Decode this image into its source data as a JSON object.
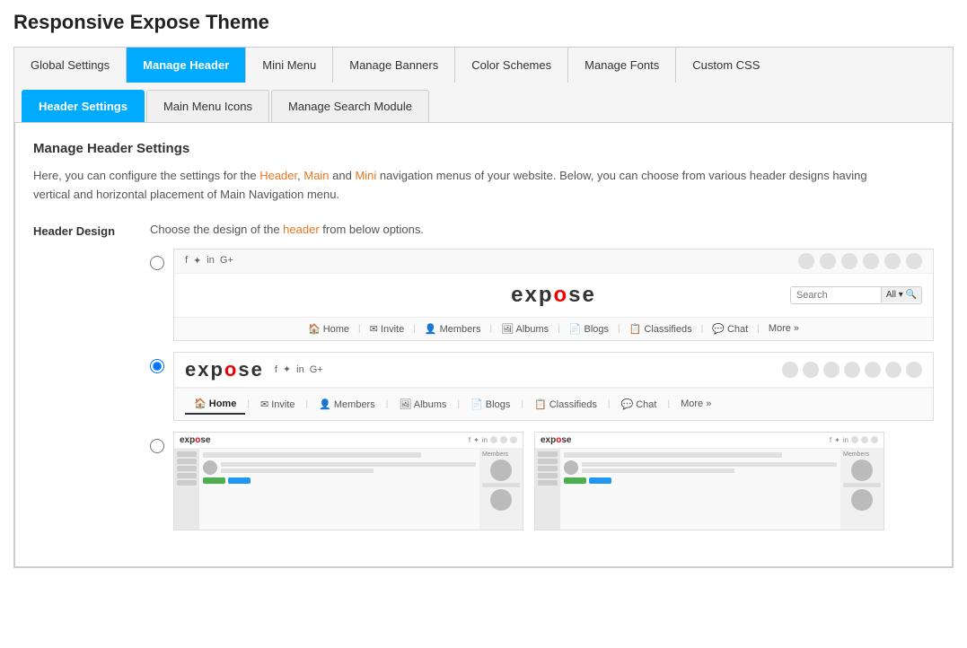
{
  "page": {
    "title": "Responsive Expose Theme"
  },
  "primary_tabs": [
    {
      "id": "global-settings",
      "label": "Global Settings",
      "active": false
    },
    {
      "id": "manage-header",
      "label": "Manage Header",
      "active": true
    },
    {
      "id": "mini-menu",
      "label": "Mini Menu",
      "active": false
    },
    {
      "id": "manage-banners",
      "label": "Manage Banners",
      "active": false
    },
    {
      "id": "color-schemes",
      "label": "Color Schemes",
      "active": false
    },
    {
      "id": "manage-fonts",
      "label": "Manage Fonts",
      "active": false
    },
    {
      "id": "custom-css",
      "label": "Custom CSS",
      "active": false
    }
  ],
  "secondary_tabs": [
    {
      "id": "header-settings",
      "label": "Header Settings",
      "active": true
    },
    {
      "id": "main-menu-icons",
      "label": "Main Menu Icons",
      "active": false
    },
    {
      "id": "manage-search-module",
      "label": "Manage Search Module",
      "active": false
    }
  ],
  "content": {
    "section_title": "Manage Header Settings",
    "section_description_1": "Here, you can configure the settings for the Header, Main and Mini navigation menus of your website. Below, you can choose from various header designs having",
    "section_description_highlight_1": "Header",
    "section_description_highlight_2": "Main",
    "section_description_highlight_3": "Mini",
    "section_description_2": "vertical and horizontal placement of Main Navigation menu.",
    "header_design_label": "Header Design",
    "field_desc_1": "Choose the design of the",
    "field_desc_highlight": "header",
    "field_desc_2": "from below options."
  },
  "nav_items": [
    "Home",
    "Invite",
    "Members",
    "Albums",
    "Blogs",
    "Classifieds",
    "Chat",
    "More »"
  ],
  "social_icons": [
    "f",
    "✦",
    "in",
    "G+"
  ]
}
